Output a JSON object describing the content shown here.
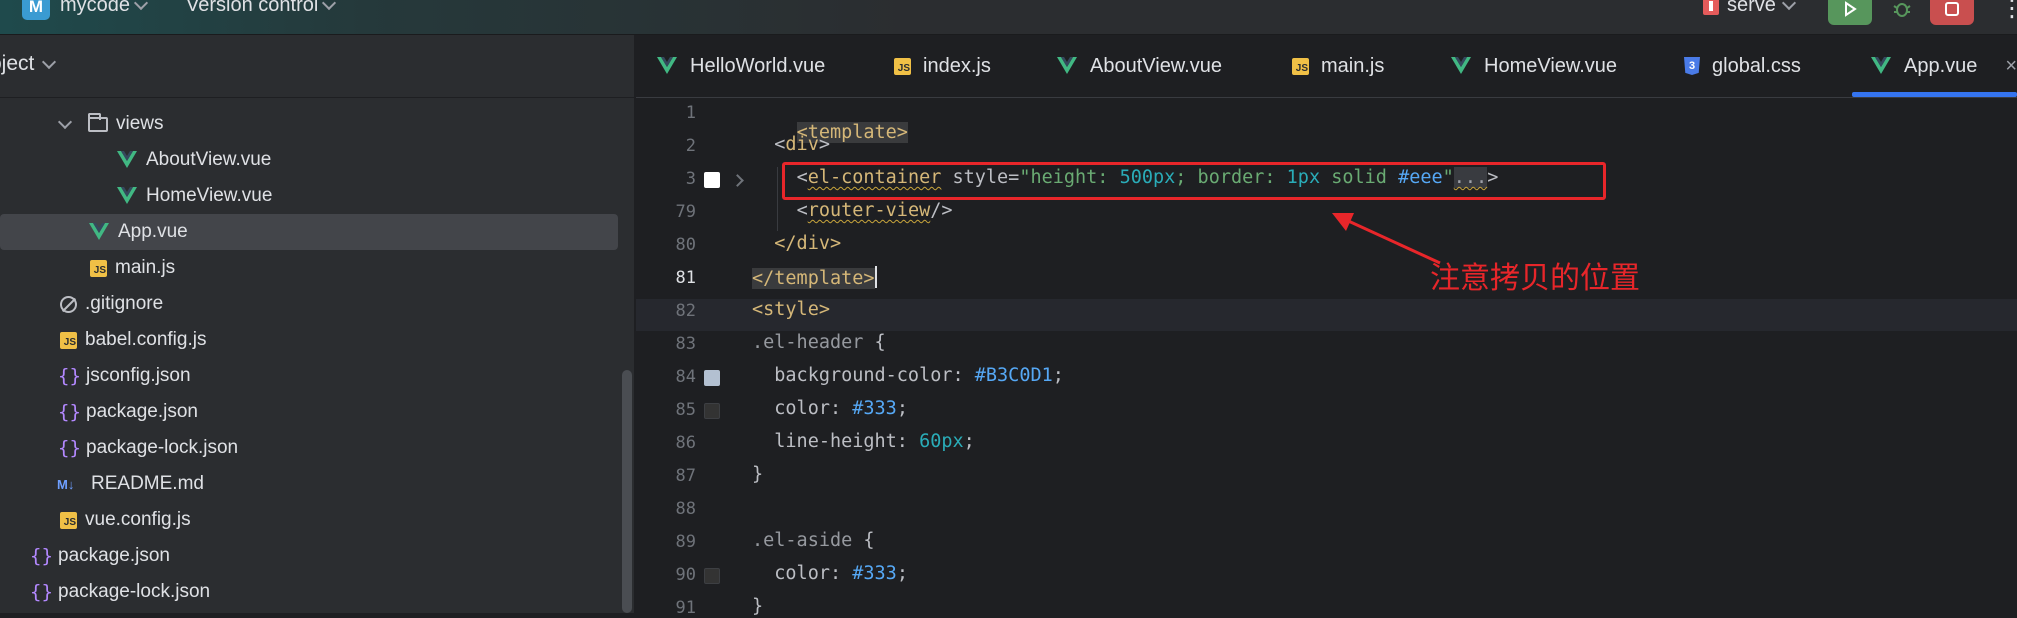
{
  "topbar": {
    "project_badge": "M",
    "project_name": "mycode",
    "vcs_label": "Version control",
    "run_config": "serve",
    "more": "⋮"
  },
  "project_panel": {
    "title": "oject",
    "tree": [
      {
        "label": "views",
        "icon": "folder-icon",
        "indent": 1,
        "expanded": true
      },
      {
        "label": "AboutView.vue",
        "icon": "vue-icon",
        "indent": 2
      },
      {
        "label": "HomeView.vue",
        "icon": "vue-icon",
        "indent": 2
      },
      {
        "label": "App.vue",
        "icon": "vue-icon",
        "indent": 1,
        "selected": true
      },
      {
        "label": "main.js",
        "icon": "js-icon",
        "indent": 1
      },
      {
        "label": ".gitignore",
        "icon": "gitignore-icon",
        "indent": 0
      },
      {
        "label": "babel.config.js",
        "icon": "js-icon",
        "indent": 0
      },
      {
        "label": "jsconfig.json",
        "icon": "json-icon",
        "indent": 0
      },
      {
        "label": "package.json",
        "icon": "json-icon",
        "indent": 0
      },
      {
        "label": "package-lock.json",
        "icon": "json-icon",
        "indent": 0
      },
      {
        "label": "README.md",
        "icon": "markdown-icon",
        "indent": 0
      },
      {
        "label": "vue.config.js",
        "icon": "js-icon",
        "indent": 0
      },
      {
        "label": "package.json",
        "icon": "json-icon",
        "indent": -1
      },
      {
        "label": "package-lock.json",
        "icon": "json-icon",
        "indent": -1
      }
    ]
  },
  "tabs": [
    {
      "label": "HelloWorld.vue",
      "icon": "vue-icon"
    },
    {
      "label": "index.js",
      "icon": "js-icon"
    },
    {
      "label": "AboutView.vue",
      "icon": "vue-icon"
    },
    {
      "label": "main.js",
      "icon": "js-icon"
    },
    {
      "label": "HomeView.vue",
      "icon": "vue-icon"
    },
    {
      "label": "global.css",
      "icon": "css-icon"
    },
    {
      "label": "App.vue",
      "icon": "vue-icon",
      "active": true
    }
  ],
  "tab_close": "×",
  "editor": {
    "line_numbers": [
      "1",
      "2",
      "3",
      "79",
      "80",
      "81",
      "82",
      "83",
      "84",
      "85",
      "86",
      "87",
      "88",
      "89",
      "90",
      "91"
    ],
    "current_line": "81",
    "lines": {
      "l1": "<template>",
      "l2_open": "<",
      "l2_tag": "div",
      "l2_close": ">",
      "l3_lt": "<",
      "l3_tag": "el-container",
      "l3_attr": " style=",
      "l3_q1": "\"height: ",
      "l3_v1": "500px",
      "l3_sep1": "; border: ",
      "l3_v2": "1px",
      "l3_solid": " solid ",
      "l3_v3": "#eee",
      "l3_q2": "\"",
      "l3_fold": "...",
      "l3_gt": ">",
      "l79_lt": "<",
      "l79_tag": "router-view",
      "l79_end": "/>",
      "l80": "</div>",
      "l81": "</template>",
      "l82": "<style>",
      "l83_sel": ".el-header",
      "l83_brace": " {",
      "l84_prop": "  background-color: ",
      "l84_val": "#B3C0D1",
      "l84_semi": ";",
      "l85_prop": "  color: ",
      "l85_val": "#333",
      "l85_semi": ";",
      "l86_prop": "  line-height: ",
      "l86_val": "60px",
      "l86_semi": ";",
      "l87": "}",
      "l88": "",
      "l89_sel": ".el-aside",
      "l89_brace": " {",
      "l90_prop": "  color: ",
      "l90_val": "#333",
      "l90_semi": ";",
      "l91": "}"
    },
    "swatches": {
      "line3": "#ffffff",
      "line84": "#b3c0d1",
      "line85": "#333333",
      "line90": "#333333"
    }
  },
  "annotation": {
    "text": "注意拷贝的位置",
    "color": "#e8262a"
  }
}
